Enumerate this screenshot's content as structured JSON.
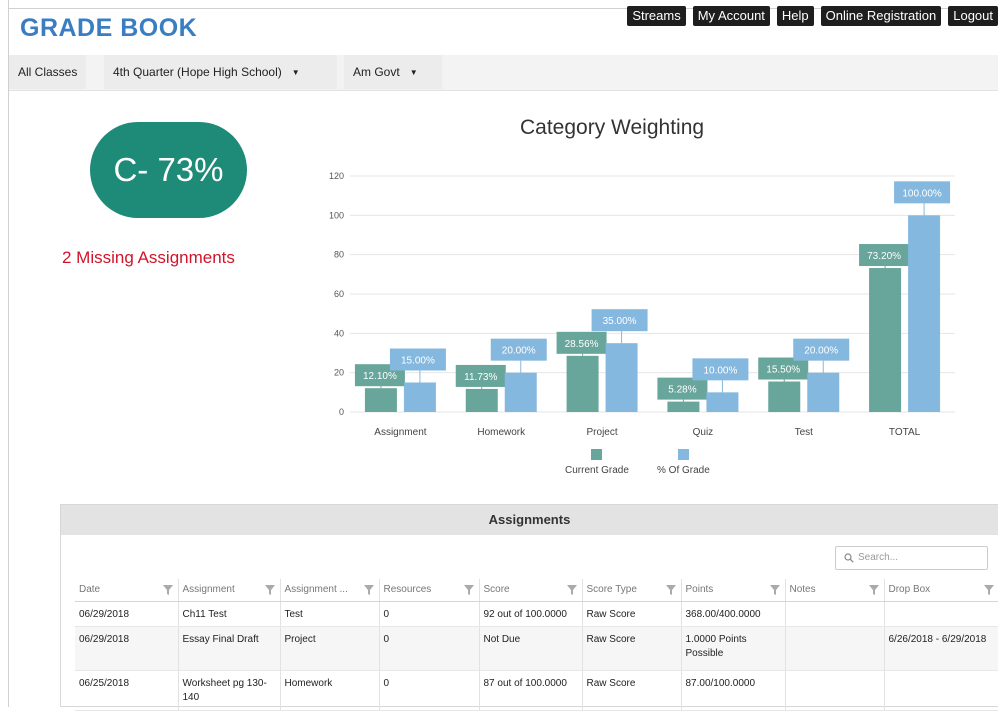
{
  "app": {
    "title": "GRADE BOOK"
  },
  "topnav": [
    "Streams",
    "My Account",
    "Help",
    "Online Registration",
    "Logout"
  ],
  "filters": {
    "all_classes": "All Classes",
    "term": "4th Quarter (Hope High School)",
    "course": "Am Govt"
  },
  "grade": {
    "display": "C- 73%"
  },
  "missing": {
    "text": "2 Missing Assignments"
  },
  "colors": {
    "current": "#68a59b",
    "percent": "#85b8df",
    "grade_pill": "#1e8a78",
    "missing": "#d0142a",
    "title": "#3a7ec1"
  },
  "chart_data": {
    "type": "bar",
    "title": "Category Weighting",
    "categories": [
      "Assignment",
      "Homework",
      "Project",
      "Quiz",
      "Test",
      "TOTAL"
    ],
    "series": [
      {
        "name": "Current Grade",
        "values": [
          12.1,
          11.73,
          28.56,
          5.28,
          15.5,
          73.2
        ],
        "labels": [
          "12.10%",
          "11.73%",
          "28.56%",
          "5.28%",
          "15.50%",
          "73.20%"
        ]
      },
      {
        "name": "% Of Grade",
        "values": [
          15.0,
          20.0,
          35.0,
          10.0,
          20.0,
          100.0
        ],
        "labels": [
          "15.00%",
          "20.00%",
          "35.00%",
          "10.00%",
          "20.00%",
          "100.00%"
        ]
      }
    ],
    "ylim": [
      0,
      120
    ],
    "yticks": [
      "0",
      "20",
      "40",
      "60",
      "80",
      "100",
      "120"
    ],
    "grid": true,
    "legend": "bottom"
  },
  "assignments": {
    "title": "Assignments",
    "search_placeholder": "Search...",
    "columns": [
      "Date",
      "Assignment",
      "Assignment ...",
      "Resources",
      "Score",
      "Score Type",
      "Points",
      "Notes",
      "Drop Box"
    ],
    "rows": [
      {
        "date": "06/29/2018",
        "assignment": "Ch11 Test",
        "type": "Test",
        "resources": "0",
        "score": "92 out of 100.0000",
        "score_type": "Raw Score",
        "points": "368.00/400.0000",
        "notes": "",
        "dropbox": ""
      },
      {
        "date": "06/29/2018",
        "assignment": "Essay Final Draft",
        "type": "Project",
        "resources": "0",
        "score": "Not Due",
        "score_type": "Raw Score",
        "points": "1.0000 Points Possible",
        "notes": "",
        "dropbox": "6/26/2018 - 6/29/2018"
      },
      {
        "date": "06/25/2018",
        "assignment": "Worksheet pg 130-140",
        "type": "Homework",
        "resources": "0",
        "score": "87 out of 100.0000",
        "score_type": "Raw Score",
        "points": "87.00/100.0000",
        "notes": "",
        "dropbox": ""
      }
    ]
  }
}
